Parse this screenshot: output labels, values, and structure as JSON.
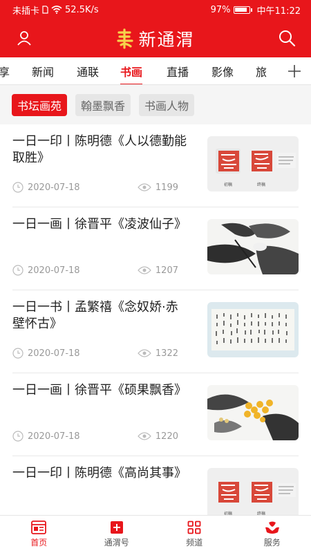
{
  "status_bar": {
    "carrier": "未插卡",
    "speed": "52.5K/s",
    "battery": "97%",
    "time": "中午11:22"
  },
  "header": {
    "title": "新通渭",
    "user_icon": "user-icon",
    "search_icon": "search-icon",
    "brand_color": "#e8161b"
  },
  "channels": [
    "享",
    "新闻",
    "通联",
    "书画",
    "直播",
    "影像",
    "旅"
  ],
  "active_channel": "书画",
  "subtabs": [
    "书坛画苑",
    "翰墨飘香",
    "书画人物"
  ],
  "articles": [
    {
      "title": "一日一印丨陈明德《人以德勤能取胜》",
      "date": "2020-07-18",
      "views": "1199",
      "thumb_caption_left": "初稿",
      "thumb_caption_right": "终稿"
    },
    {
      "title": "一日一画丨徐晋平《凌波仙子》",
      "date": "2020-07-18",
      "views": "1207"
    },
    {
      "title": "一日一书丨孟繁禧《念奴娇·赤壁怀古》",
      "date": "2020-07-18",
      "views": "1322"
    },
    {
      "title": "一日一画丨徐晋平《硕果飘香》",
      "date": "2020-07-18",
      "views": "1220"
    },
    {
      "title": "一日一印丨陈明德《高尚其事》",
      "date": "",
      "views": "",
      "thumb_caption_left": "初稿",
      "thumb_caption_right": "终稿"
    }
  ],
  "bottom_nav": [
    {
      "label": "首页",
      "icon": "news-icon"
    },
    {
      "label": "通渭号",
      "icon": "plus-square-icon"
    },
    {
      "label": "频道",
      "icon": "grid-icon"
    },
    {
      "label": "服务",
      "icon": "hands-icon"
    }
  ]
}
